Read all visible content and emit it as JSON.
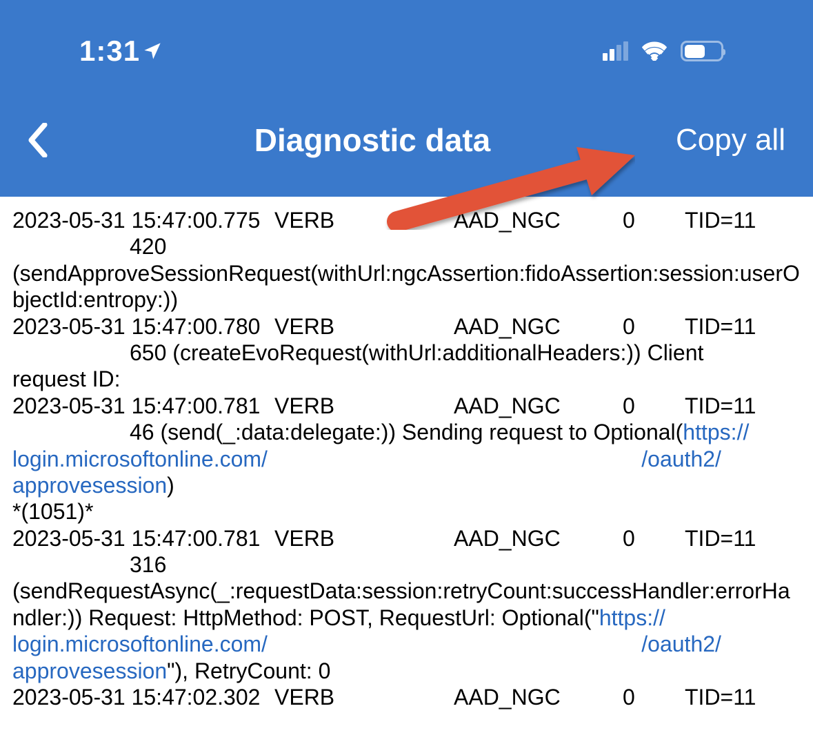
{
  "statusBar": {
    "time": "1:31"
  },
  "navBar": {
    "title": "Diagnostic data",
    "copyAll": "Copy all"
  },
  "logs": {
    "e1": {
      "ts": "2023-05-31 15:47:00.775",
      "level": "VERB",
      "cat": "AAD_NGC",
      "zero": "0",
      "tid": "TID=11",
      "indent": "420",
      "body": "(sendApproveSessionRequest(withUrl:ngcAssertion:fidoAssertion:session:userObjectId:entropy:))"
    },
    "e2": {
      "ts": "2023-05-31 15:47:00.780",
      "level": "VERB",
      "cat": "AAD_NGC",
      "zero": "0",
      "tid": "TID=11",
      "indent": "650 (createEvoRequest(withUrl:additionalHeaders:)) Client",
      "body": "request ID:"
    },
    "e3": {
      "ts": "2023-05-31 15:47:00.781",
      "level": "VERB",
      "cat": "AAD_NGC",
      "zero": "0",
      "tid": "TID=11",
      "indentPre": "46 (send(_:data:delegate:)) Sending request to Optional(",
      "link1a": "https://",
      "link1b": "login.microsoftonline.com/",
      "spacer": "                                                             ",
      "link1c": "/oauth2/",
      "link1d": "approvesession",
      "after": ")",
      "star": "*(1051)*"
    },
    "e4": {
      "ts": "2023-05-31 15:47:00.781",
      "level": "VERB",
      "cat": "AAD_NGC",
      "zero": "0",
      "tid": "TID=11",
      "indent": "316",
      "body1": "(sendRequestAsync(_:requestData:session:retryCount:successHandler:errorHandler:)) Request: HttpMethod: POST, RequestUrl: Optional(\"",
      "link1a": "https://",
      "link1b": "login.microsoftonline.com/",
      "spacer": "                                                             ",
      "link1c": "/oauth2/",
      "link1d": "approvesession",
      "body2": "\"), RetryCount: 0"
    },
    "e5": {
      "ts": "2023-05-31 15:47:02.302",
      "level": "VERB",
      "cat": "AAD_NGC",
      "zero": "0",
      "tid": "TID=11"
    }
  }
}
